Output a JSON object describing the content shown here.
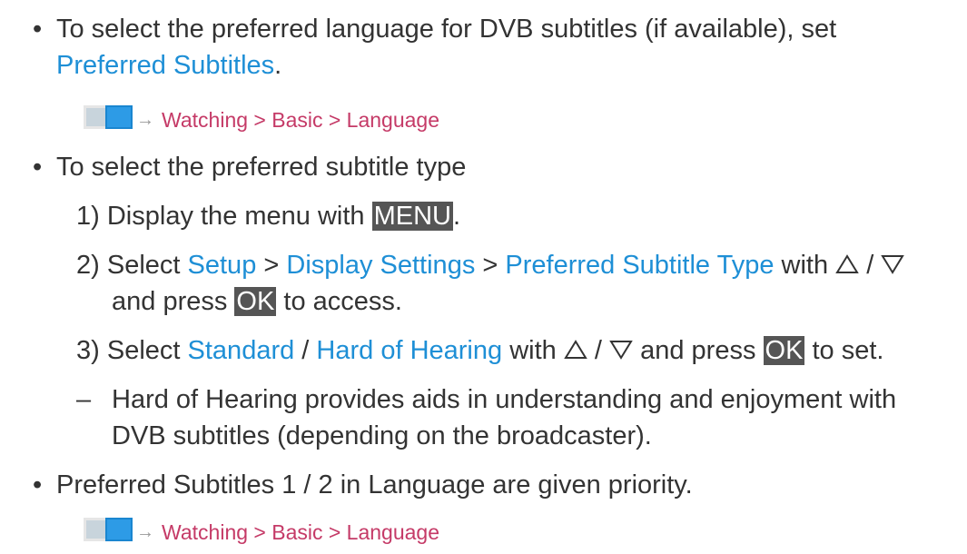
{
  "bullet1": {
    "line1": "To select the preferred language for DVB subtitles (if available), set",
    "link": "Preferred Subtitles",
    "period": "."
  },
  "ref1": "Watching > Basic > Language",
  "bullet2": {
    "text": "To select the preferred subtitle type"
  },
  "step1": {
    "num": "1)",
    "pre": "Display the menu with",
    "key": "MENU",
    "post": "."
  },
  "step2": {
    "num": "2)",
    "pre": "Select",
    "link1": "Setup",
    "sep1": ">",
    "link2": "Display Settings",
    "sep2": ">",
    "link3": "Preferred Subtitle Type",
    "with": "with",
    "slash": "/",
    "line2_pre": "and press",
    "key": "OK",
    "line2_post": "to access."
  },
  "step3": {
    "num": "3)",
    "pre": "Select",
    "link1": "Standard",
    "slash": "/",
    "link2": "Hard of Hearing",
    "with": "with",
    "slash2": "/",
    "mid": "and press",
    "key": "OK",
    "post": "to set."
  },
  "note": {
    "dash": "–",
    "line1": "Hard of Hearing provides aids in understanding and enjoyment with",
    "line2": "DVB subtitles (depending on the broadcaster)."
  },
  "bullet3": {
    "text": "Preferred Subtitles 1 / 2 in Language are given priority."
  },
  "ref2": "Watching > Basic > Language",
  "glyphs": {
    "bullet": "•",
    "arrow": "→"
  },
  "colors": {
    "text": "#333333",
    "link": "#1e8fd6",
    "ref": "#c53a67",
    "key_bg": "#555555"
  }
}
